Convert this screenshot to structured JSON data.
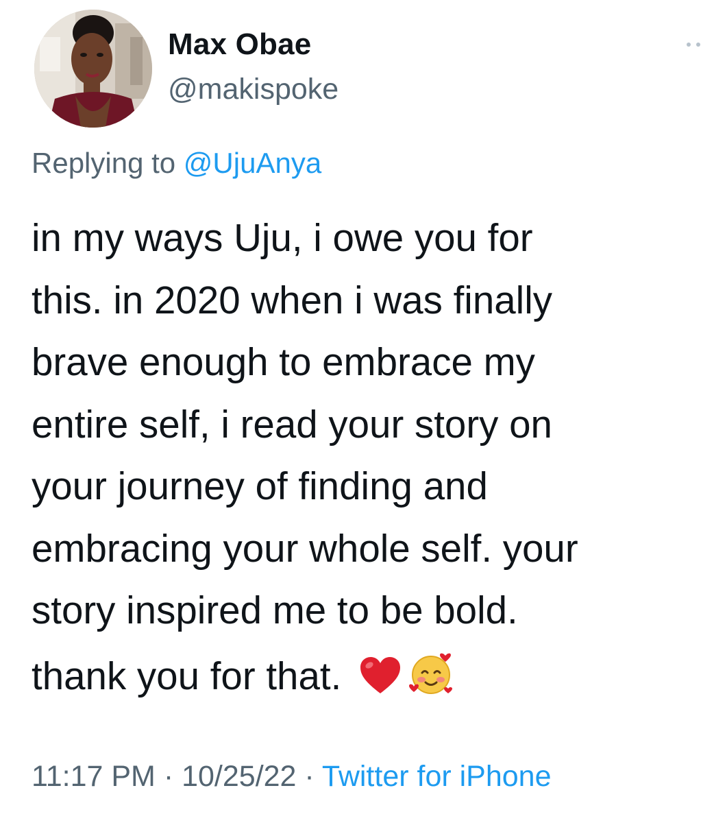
{
  "tweet": {
    "author_name": "Max Obae",
    "author_handle": "@makispoke",
    "replying_prefix": "Replying to ",
    "replying_to": "@UjuAnya",
    "body": "in my ways Uju, i owe you for\nthis. in 2020 when i was finally\nbrave enough to embrace my\nentire self, i read your story on\nyour journey of finding and\nembracing your whole self. your\nstory inspired me to be bold.",
    "closing": "thank you for that.",
    "emojis": [
      "red-heart-emoji",
      "smiling-face-with-hearts-emoji"
    ],
    "time": "11:17 PM",
    "date": "10/25/22",
    "separator": " · ",
    "source": "Twitter for iPhone"
  },
  "colors": {
    "text": "#0f1419",
    "secondary": "#536471",
    "accent": "#1d9bf0",
    "more_dots": "#b7c2cc"
  },
  "icons": {
    "more": "more-options-icon",
    "avatar": "profile-photo"
  }
}
